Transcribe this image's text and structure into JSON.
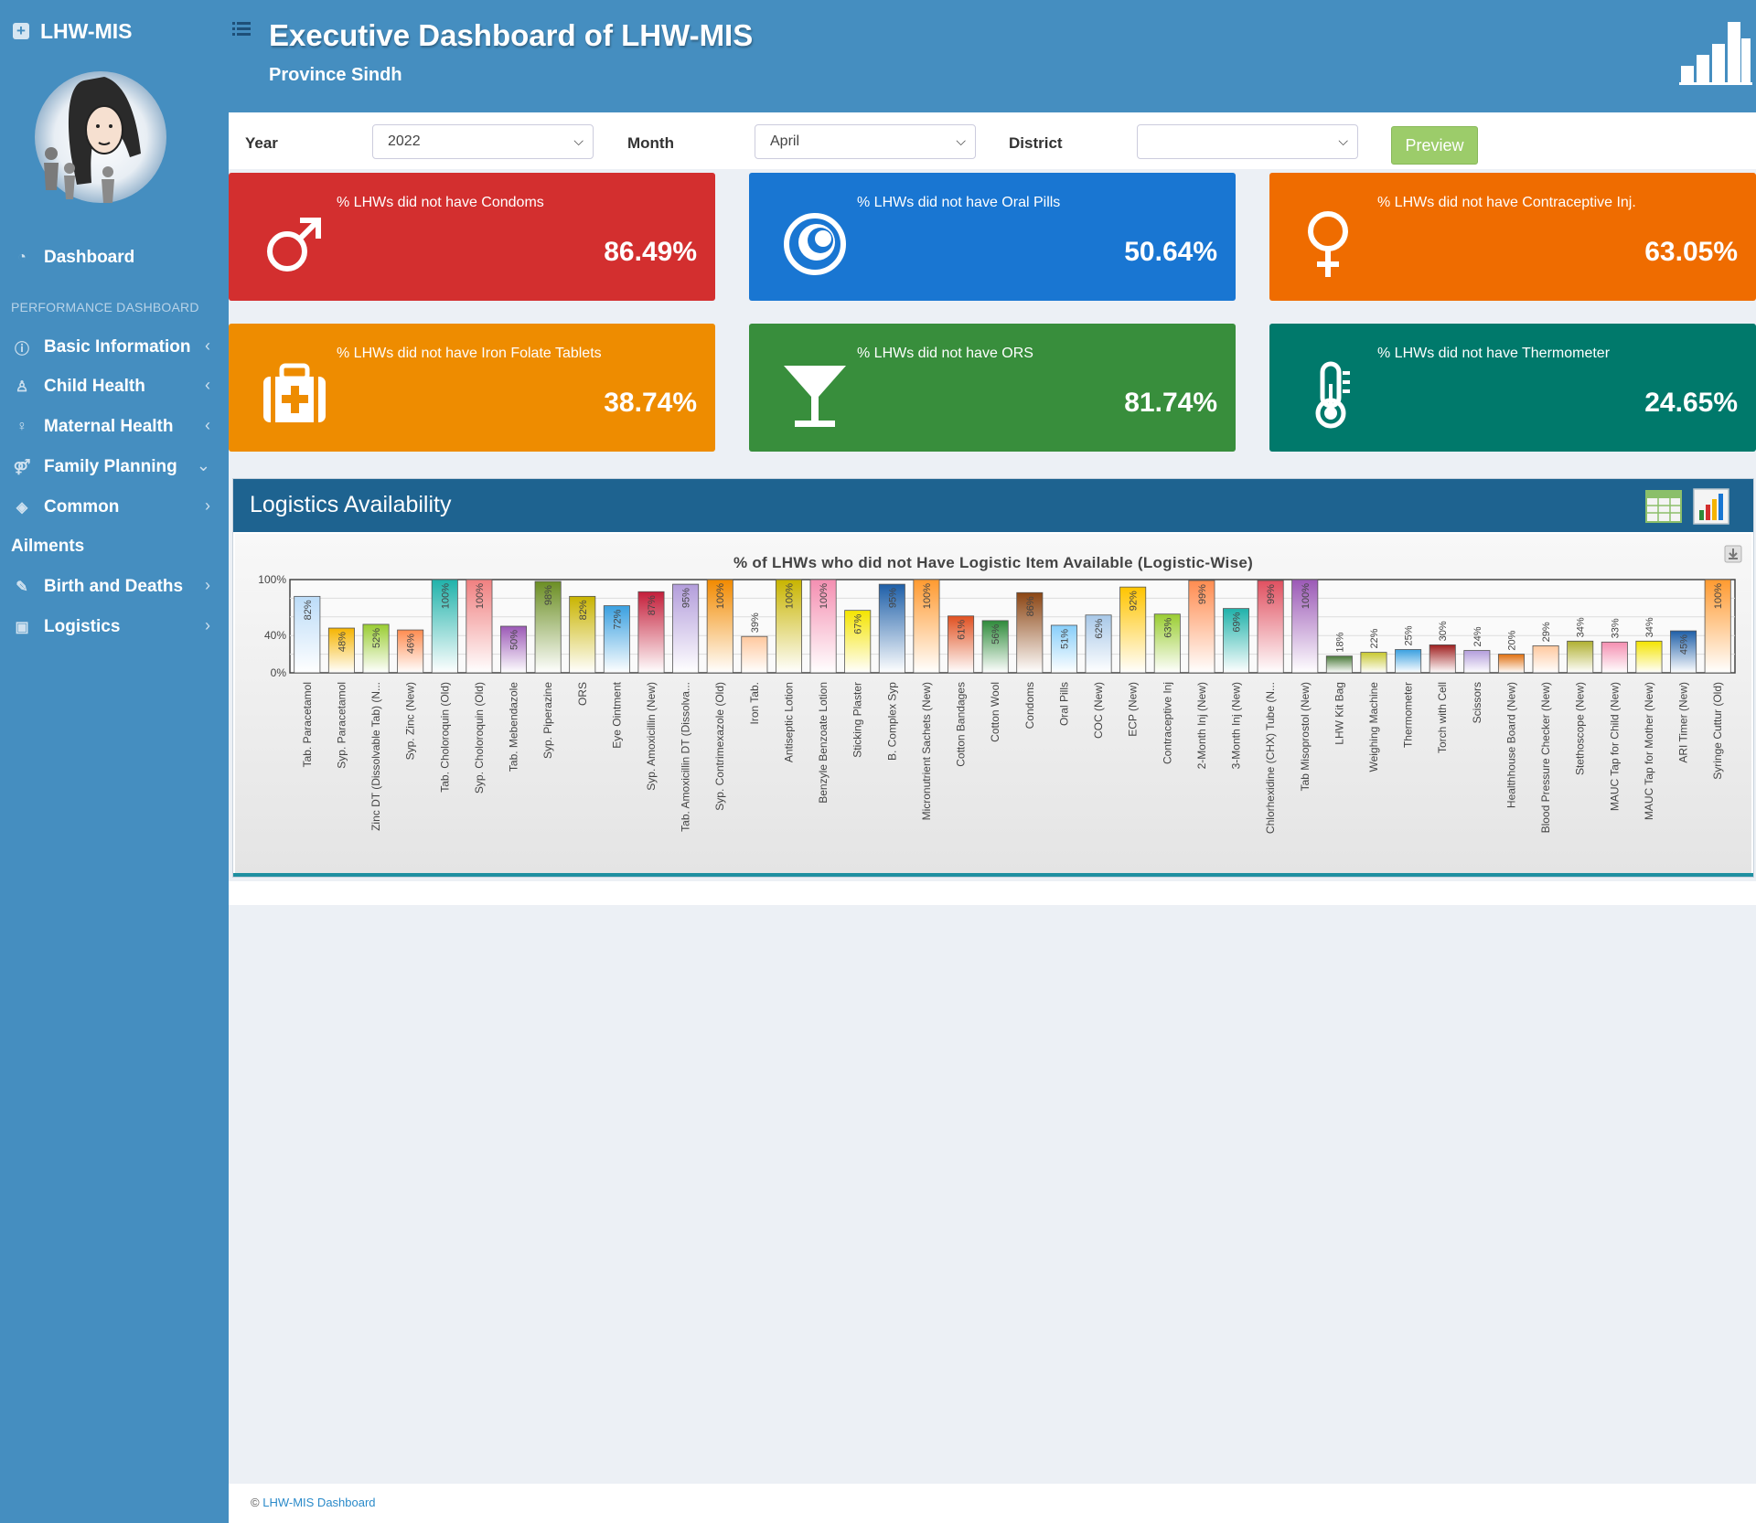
{
  "app": {
    "brand": "LHW-MIS",
    "title": "Executive Dashboard of LHW-MIS",
    "subtitle": "Province Sindh"
  },
  "sidebar": {
    "dashboard": "Dashboard",
    "section_header": "PERFORMANCE DASHBOARD",
    "items": [
      {
        "label": "Basic Information",
        "icon": "info-icon",
        "arrow": "‹"
      },
      {
        "label": "Child Health",
        "icon": "child-icon",
        "arrow": "‹"
      },
      {
        "label": "Maternal Health",
        "icon": "mother-icon",
        "arrow": "‹"
      },
      {
        "label": "Family Planning",
        "icon": "gender-icon",
        "arrow": "⌄"
      },
      {
        "label": "Common",
        "icon": "tag-icon",
        "arrow": "›"
      },
      {
        "label": "Ailments",
        "icon": "",
        "arrow": ""
      },
      {
        "label": "Birth and Deaths",
        "icon": "wrench-icon",
        "arrow": "›"
      },
      {
        "label": "Logistics",
        "icon": "medkit-icon",
        "arrow": "›"
      }
    ]
  },
  "filters": {
    "year_label": "Year",
    "year_value": "2022",
    "month_label": "Month",
    "month_value": "April",
    "district_label": "District",
    "district_value": "",
    "preview_label": "Preview"
  },
  "cards": [
    {
      "label": "% LHWs did not have Condoms",
      "value": "86.49%",
      "color": "#d32f2f",
      "icon": "male-icon"
    },
    {
      "label": "% LHWs did not have Oral Pills",
      "value": "50.64%",
      "color": "#1976d2",
      "icon": "pill-icon"
    },
    {
      "label": "% LHWs did not have Contraceptive Inj.",
      "value": "63.05%",
      "color": "#ef6c00",
      "icon": "female-icon"
    },
    {
      "label": "% LHWs did not have Iron Folate Tablets",
      "value": "38.74%",
      "color": "#ee8c00",
      "icon": "medkit-icon"
    },
    {
      "label": "% LHWs did not have ORS",
      "value": "81.74%",
      "color": "#388e3c",
      "icon": "glass-icon"
    },
    {
      "label": "% LHWs did not have Thermometer",
      "value": "24.65%",
      "color": "#00796b",
      "icon": "thermometer-icon"
    }
  ],
  "panel": {
    "title": "Logistics Availability"
  },
  "chart_data": {
    "type": "bar",
    "title": "% of LHWs who did not Have Logistic Item Available (Logistic-Wise)",
    "y_ticks": [
      "100%",
      "40%",
      "0%"
    ],
    "ylim": [
      0,
      100
    ],
    "categories": [
      "Tab. Paracetamol",
      "Syp. Paracetamol",
      "Zinc DT (Dissolvable Tab) (N...",
      "Syp. Zinc (New)",
      "Tab. Choloroquin (Old)",
      "Syp. Choloroquin (Old)",
      "Tab. Mebendazole",
      "Syp. Piperazine",
      "ORS",
      "Eye Ointment",
      "Syp. Amoxicillin (New)",
      "Tab. Amoxicillin DT (Dissolva...",
      "Syp. Contrimexazole (Old)",
      "Iron Tab.",
      "Antiseptic Lotion",
      "Benzyle Benzoate Lotion",
      "Sticking Plaster",
      "B. Complex Syp",
      "Micronutrient Sachets (New)",
      "Cotton Bandages",
      "Cotton Wool",
      "Condoms",
      "Oral Pills",
      "COC (New)",
      "ECP (New)",
      "Contraceptive Inj",
      "2-Month Inj (New)",
      "3-Month Inj (New)",
      "Chlorhexidine (CHX) Tube (N...",
      "Tab Misoprostol (New)",
      "LHW Kit Bag",
      "Weighing Machine",
      "Thermometer",
      "Torch with Cell",
      "Scissors",
      "Healthhouse Board (New)",
      "Blood Pressure Checker (New)",
      "Stethoscope (New)",
      "MAUC Tap for Child (New)",
      "MAUC Tap for Mother (New)",
      "ARI Timer (New)",
      "Syringe Cuttur (Old)"
    ],
    "values": [
      82,
      48,
      52,
      46,
      100,
      100,
      50,
      98,
      82,
      72,
      87,
      95,
      100,
      39,
      100,
      100,
      67,
      95,
      100,
      61,
      56,
      86,
      51,
      62,
      92,
      63,
      99,
      69,
      99,
      100,
      18,
      22,
      25,
      30,
      24,
      20,
      29,
      34,
      33,
      34,
      45,
      100
    ],
    "labels": [
      "82%",
      "48%",
      "52%",
      "46%",
      "100%",
      "100%",
      "50%",
      "98%",
      "82%",
      "72%",
      "87%",
      "95%",
      "100%",
      "39%",
      "100%",
      "100%",
      "67%",
      "95%",
      "100%",
      "61%",
      "56%",
      "86%",
      "51%",
      "62%",
      "92%",
      "63%",
      "99%",
      "69%",
      "99%",
      "100%",
      "18%",
      "22%",
      "25%",
      "30%",
      "24%",
      "20%",
      "29%",
      "34%",
      "33%",
      "34%",
      "45%",
      "100%"
    ],
    "colors": [
      "#bcdcf8",
      "#f5b400",
      "#9acd32",
      "#ff8c50",
      "#20b2aa",
      "#f08080",
      "#9b59b6",
      "#6b8e23",
      "#c9b400",
      "#3aa0e0",
      "#c41e3a",
      "#b39ddb",
      "#f28a00",
      "#ffc89e",
      "#c8b400",
      "#f48fb1",
      "#f4e400",
      "#1e5fa8",
      "#ff9a30",
      "#e05020",
      "#2e8b3a",
      "#8b4513",
      "#87cefa",
      "#a8c8e8",
      "#ffc400",
      "#9acd32",
      "#ff8c50",
      "#20b2aa",
      "#e05060",
      "#9b59b6",
      "#4a7a3a",
      "#c8c830",
      "#3aa0e0",
      "#a02020",
      "#b39ddb",
      "#e07010",
      "#ffc89e",
      "#b0b030",
      "#f48fb1",
      "#f4e400",
      "#1e5fa8",
      "#ff9a30"
    ]
  },
  "footer": {
    "copyright": "©",
    "link": "LHW-MIS Dashboard"
  }
}
